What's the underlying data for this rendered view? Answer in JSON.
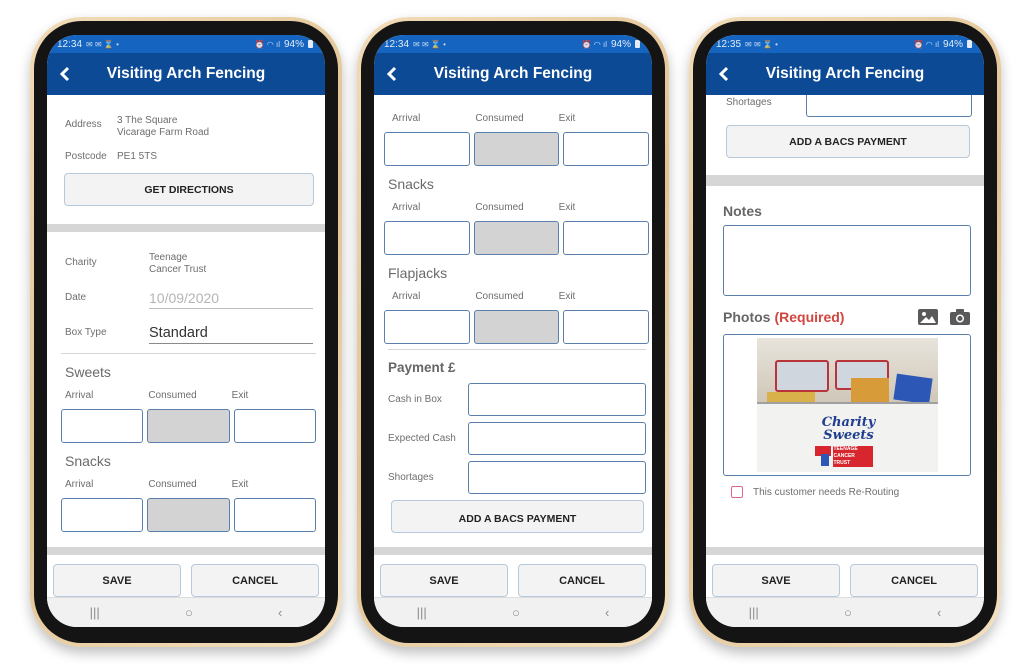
{
  "app": {
    "title": "Visiting Arch Fencing",
    "brand_color": "#0d4a96",
    "statusbar_color": "#1565c0"
  },
  "common": {
    "battery": "94%",
    "save_label": "SAVE",
    "cancel_label": "CANCEL",
    "nav": {
      "recents": "|||",
      "home": "○",
      "back": "‹"
    },
    "labels": {
      "arrival": "Arrival",
      "consumed": "Consumed",
      "exit": "Exit"
    }
  },
  "screens": [
    {
      "time": "12:34",
      "address_label": "Address",
      "address_line1": "3 The Square",
      "address_line2": "Vicarage Farm Road",
      "postcode_label": "Postcode",
      "postcode": "PE1 5TS",
      "directions_label": "GET DIRECTIONS",
      "charity_label": "Charity",
      "charity_line1": "Teenage",
      "charity_line2": "Cancer Trust",
      "date_label": "Date",
      "date_value": "10/09/2020",
      "box_type_label": "Box Type",
      "box_type_value": "Standard",
      "sections": [
        "Sweets",
        "Snacks"
      ]
    },
    {
      "time": "12:34",
      "sections": [
        "Snacks",
        "Flapjacks"
      ],
      "payment_title": "Payment £",
      "cash_in_box_label": "Cash in Box",
      "expected_cash_label": "Expected Cash",
      "shortages_label": "Shortages",
      "bacs_label": "ADD A BACS PAYMENT"
    },
    {
      "time": "12:35",
      "shortages_label": "Shortages",
      "bacs_label": "ADD A BACS PAYMENT",
      "notes_label": "Notes",
      "photos_label": "Photos",
      "photos_required": "(Required)",
      "required_color": "#d0463f",
      "photo_caption": "Charity Sweets",
      "photo_sub": "TEENAGE CANCER TRUST",
      "rerouting_label": "This customer needs Re-Routing",
      "rerouting_checked": false
    }
  ]
}
